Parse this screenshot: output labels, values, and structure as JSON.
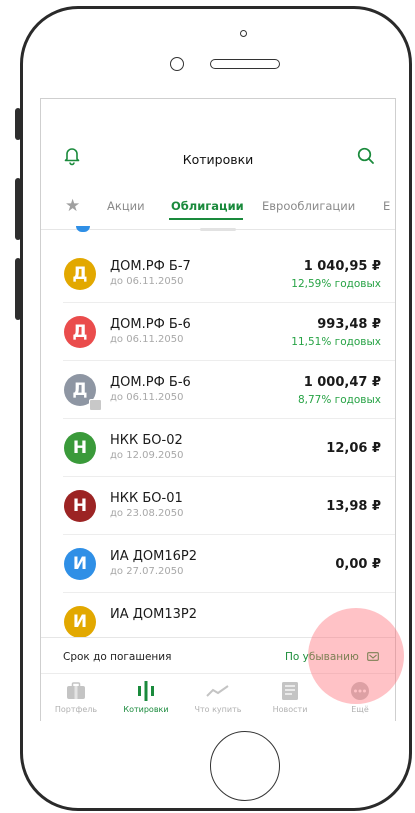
{
  "header": {
    "title": "Котировки",
    "bell_icon": "bell-icon",
    "search_icon": "search-icon"
  },
  "tabs": [
    {
      "label": "Акции"
    },
    {
      "label": "Облигации",
      "active": true
    },
    {
      "label": "Еврооблигации"
    },
    {
      "label": "Е"
    }
  ],
  "bonds": [
    {
      "initial": "Д",
      "color": "#e2a800",
      "name": "ДОМ.РФ Б-7",
      "date": "до 06.11.2050",
      "price": "1 040,95 ₽",
      "yield": "12,59% годовых"
    },
    {
      "initial": "Д",
      "color": "#ea4c4c",
      "name": "ДОМ.РФ Б-6",
      "date": "до 06.11.2050",
      "price": "993,48 ₽",
      "yield": "11,51% годовых"
    },
    {
      "initial": "Д",
      "color": "#8e96a3",
      "name": "ДОМ.РФ Б-6",
      "date": "до 06.11.2050",
      "price": "1 000,47 ₽",
      "yield": "8,77% годовых",
      "badge": true
    },
    {
      "initial": "Н",
      "color": "#3a9a3a",
      "name": "НКК БО-02",
      "date": "до 12.09.2050",
      "price": "12,06 ₽"
    },
    {
      "initial": "Н",
      "color": "#9c2424",
      "name": "НКК БО-01",
      "date": "до 23.08.2050",
      "price": "13,98 ₽"
    },
    {
      "initial": "И",
      "color": "#2f8fe6",
      "name": "ИА ДОМ16Р2",
      "date": "до 27.07.2050",
      "price": "0,00 ₽"
    },
    {
      "initial": "И",
      "color": "#e2a800",
      "name": "ИА ДОМ13Р2",
      "date": "",
      "price": ""
    }
  ],
  "sort": {
    "label": "Срок до погашения",
    "value": "По убыванию"
  },
  "bottom_nav": [
    {
      "label": "Портфель",
      "icon": "briefcase-icon"
    },
    {
      "label": "Котировки",
      "icon": "quotes-chart-icon",
      "active": true
    },
    {
      "label": "Что купить",
      "icon": "trend-icon"
    },
    {
      "label": "Новости",
      "icon": "news-icon"
    },
    {
      "label": "Ещё",
      "icon": "more-icon"
    }
  ],
  "colors": {
    "accent_green": "#1a8a3c",
    "yield_green": "#27a345",
    "tap_highlight": "#ff6e78"
  }
}
